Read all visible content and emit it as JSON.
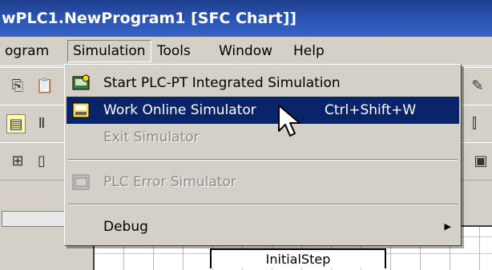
{
  "window": {
    "title": "wPLC1.NewProgram1 [SFC Chart]]"
  },
  "menubar": {
    "items": [
      "ogram",
      "Simulation",
      "Tools",
      "Window",
      "Help"
    ]
  },
  "dropdown": {
    "items": [
      {
        "label": "Start PLC-PT Integrated Simulation",
        "shortcut": "",
        "icon": "plc-pt-simulation-icon",
        "enabled": true
      },
      {
        "label": "Work Online Simulator",
        "shortcut": "Ctrl+Shift+W",
        "icon": "online-simulator-icon",
        "enabled": true,
        "selected": true
      },
      {
        "label": "Exit Simulator",
        "shortcut": "",
        "icon": "",
        "enabled": false
      },
      {
        "label": "PLC Error Simulator",
        "shortcut": "",
        "icon": "plc-error-simulator-icon",
        "enabled": false
      },
      {
        "label": "Debug",
        "shortcut": "",
        "icon": "",
        "enabled": true,
        "submenu": true
      }
    ]
  },
  "chart": {
    "step_label": "InitialStep"
  },
  "colors": {
    "titlebar": "#2d57b8",
    "selection": "#0a246a",
    "menu_bg": "#d4d0c8"
  }
}
